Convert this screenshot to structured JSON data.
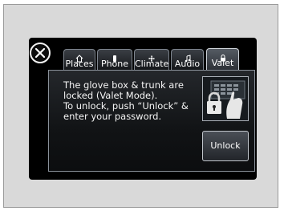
{
  "tabs": [
    {
      "label": "Places",
      "icon": "home-icon"
    },
    {
      "label": "Phone",
      "icon": "phone-icon"
    },
    {
      "label": "Climate",
      "icon": "fan-icon"
    },
    {
      "label": "Audio",
      "icon": "music-note-icon"
    },
    {
      "label": "Valet",
      "icon": "lock-icon",
      "active": true
    }
  ],
  "message": {
    "lines": [
      "The glove box & trunk are",
      "locked (Valet Mode).",
      "To unlock, push “Unlock” &",
      "enter your password."
    ]
  },
  "unlock_button": {
    "label": "Unlock"
  },
  "colors": {
    "screen_bg": "#000000",
    "text": "#ffffff",
    "frame": "#d9d9d9"
  }
}
